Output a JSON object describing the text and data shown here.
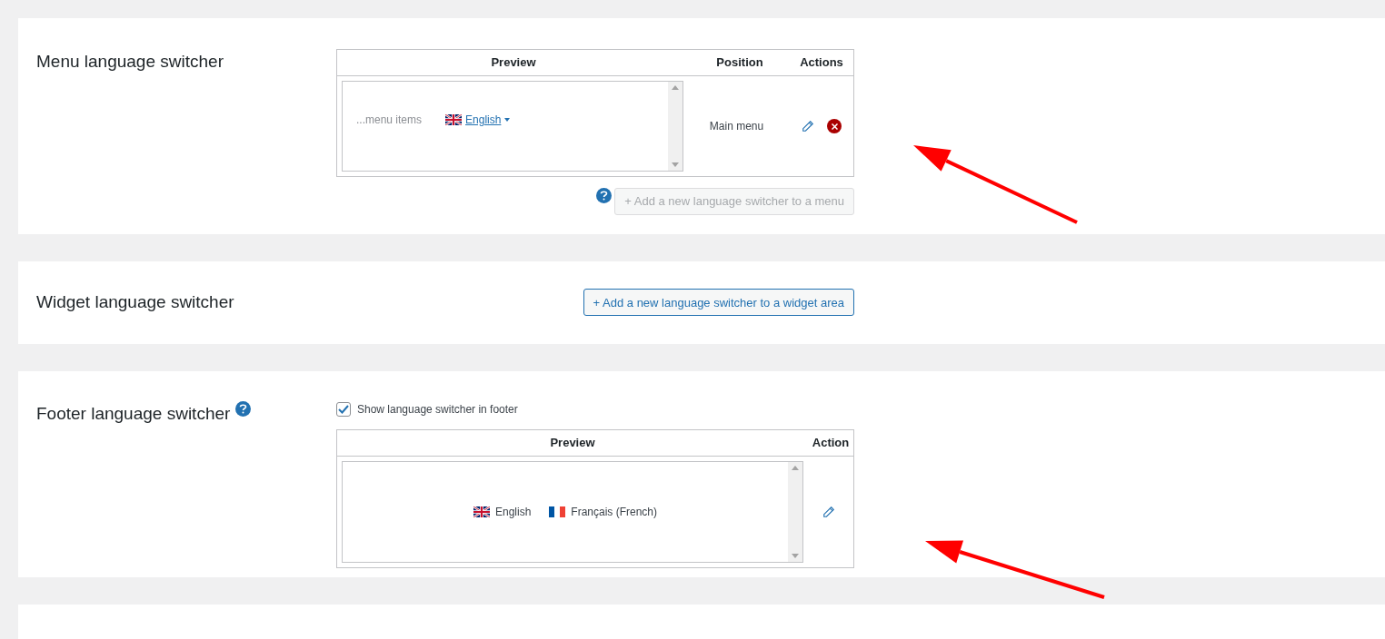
{
  "menu_switcher": {
    "title": "Menu language switcher",
    "columns": [
      "Preview",
      "Position",
      "Actions"
    ],
    "rows": [
      {
        "preview_prefix": "...menu items",
        "language": {
          "kind": "uk",
          "label": "English"
        },
        "position": "Main menu"
      }
    ],
    "add_button": {
      "label": "+ Add a new language switcher to a menu",
      "disabled": true
    }
  },
  "widget_switcher": {
    "title": "Widget language switcher",
    "add_button": {
      "label": "+ Add a new language switcher to a widget area",
      "disabled": false
    }
  },
  "footer_switcher": {
    "title": "Footer language switcher",
    "show_checkbox": {
      "label": "Show language switcher in footer",
      "checked": true
    },
    "columns": [
      "Preview",
      "Action"
    ],
    "languages": [
      {
        "kind": "uk",
        "label": "English"
      },
      {
        "kind": "fr",
        "label": "Français (French)"
      }
    ]
  }
}
